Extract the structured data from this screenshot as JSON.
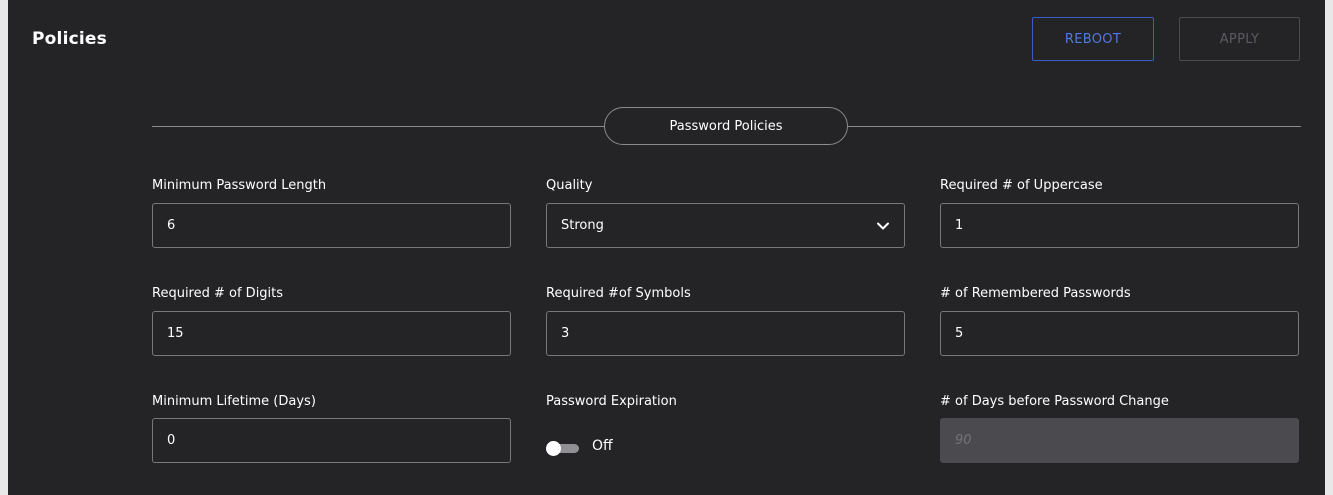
{
  "header": {
    "title": "Policies",
    "reboot_label": "REBOOT",
    "apply_label": "APPLY"
  },
  "section": {
    "title": "Password Policies"
  },
  "fields": {
    "min_length": {
      "label": "Minimum Password Length",
      "value": "6"
    },
    "quality": {
      "label": "Quality",
      "value": "Strong"
    },
    "uppercase": {
      "label": "Required # of Uppercase",
      "value": "1"
    },
    "digits": {
      "label": "Required # of Digits",
      "value": "15"
    },
    "symbols": {
      "label": "Required #of Symbols",
      "value": "3"
    },
    "remembered": {
      "label": "# of Remembered Passwords",
      "value": "5"
    },
    "min_lifetime": {
      "label": "Minimum Lifetime (Days)",
      "value": "0"
    },
    "expiration": {
      "label": "Password Expiration",
      "state": "Off",
      "enabled": false
    },
    "days_before_change": {
      "label": "# of Days before Password Change",
      "placeholder": "90"
    }
  },
  "icons": {
    "quality_dropdown": "chevron-down-icon"
  },
  "colors": {
    "background": "#242427",
    "accent": "#4f79e4",
    "border": "#77777c",
    "disabled_fill": "#4a4a4f"
  }
}
